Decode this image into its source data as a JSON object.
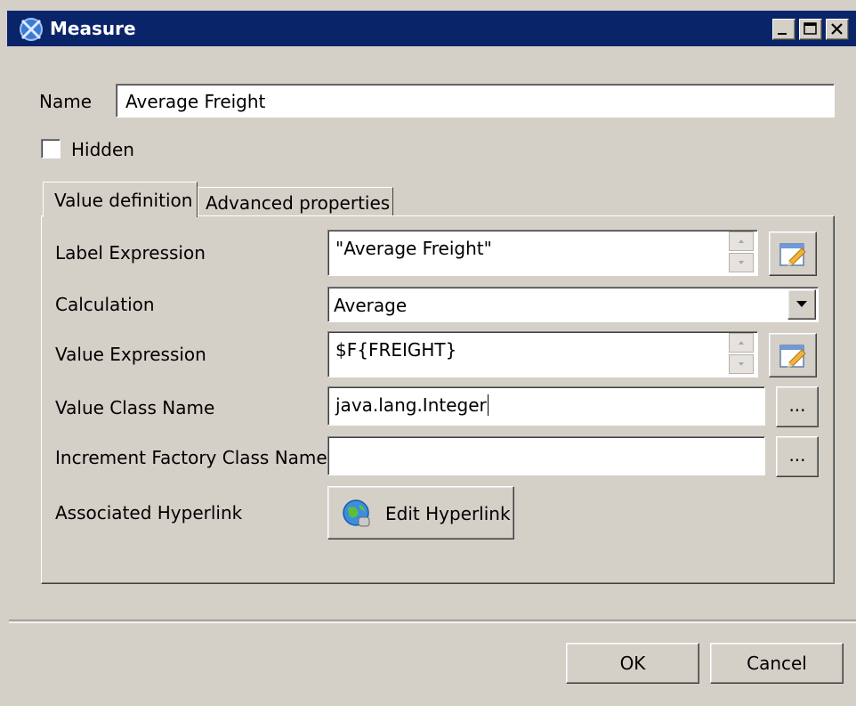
{
  "window": {
    "title": "Measure",
    "title_bar_color": "#0a246a",
    "controls": [
      "minimize-icon",
      "maximize-icon",
      "close-icon"
    ]
  },
  "name_field": {
    "label": "Name",
    "value": "Average Freight"
  },
  "hidden_checkbox": {
    "label": "Hidden",
    "checked": false
  },
  "tabs": [
    {
      "label": "Value definition",
      "active": true
    },
    {
      "label": "Advanced properties",
      "active": false
    }
  ],
  "form": {
    "label_expression": {
      "label": "Label Expression",
      "value": "\"Average Freight\""
    },
    "calculation": {
      "label": "Calculation",
      "value": "Average"
    },
    "value_expression": {
      "label": "Value Expression",
      "value": "$F{FREIGHT}"
    },
    "value_class_name": {
      "label": "Value Class Name",
      "value": "java.lang.Integer",
      "browse": "..."
    },
    "increment_factory": {
      "label": "Increment Factory Class Name",
      "value": "",
      "browse": "..."
    },
    "hyperlink": {
      "label": "Associated Hyperlink",
      "button": "Edit Hyperlink"
    }
  },
  "footer": {
    "ok": "OK",
    "cancel": "Cancel"
  }
}
